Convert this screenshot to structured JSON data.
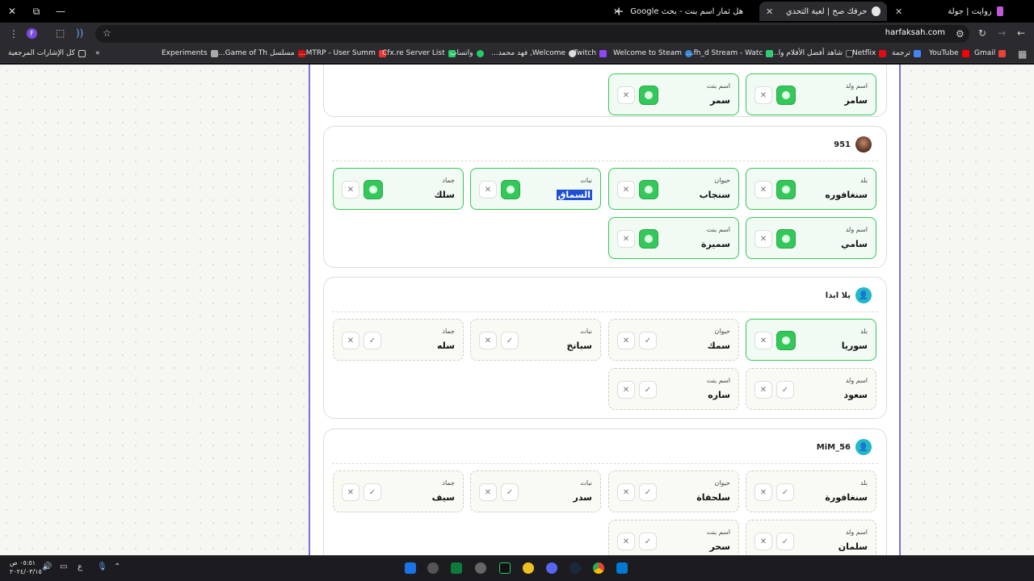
{
  "browser": {
    "tabs": [
      {
        "title": "روايت | جولة",
        "active": false
      },
      {
        "title": "حرفك صح | لعبة التحدي والكلمات",
        "active": true
      },
      {
        "title": "هل ثمار اسم بنت - بحث Google",
        "active": false
      }
    ],
    "url": "harfaksah.com",
    "profile_letter": "F",
    "bookmarks": [
      "Gmail",
      "YouTube",
      "ترجمة",
      "Netflix",
      "شاهد أفضل الأفلام وا...",
      "fh_d Stream - Watc...",
      "Welcome to Steam",
      "Twitch",
      "Welcome, فهد محمد...",
      "واتساب",
      "Cfx.re Server List",
      "MTRP - User Summ...",
      "مسلسل Game of Th...",
      "Experiments"
    ],
    "all_bookmarks": "كل الإشارات المرجعية",
    "overflow": "»"
  },
  "cards": [
    {
      "player": "",
      "answers": [
        {
          "category": "اسم ولد",
          "value": "سامر",
          "approved": true
        },
        {
          "category": "اسم بنت",
          "value": "سمر",
          "approved": true
        }
      ]
    },
    {
      "player": "951",
      "answers": [
        {
          "category": "بلد",
          "value": "سنغافوره",
          "approved": true
        },
        {
          "category": "حيوان",
          "value": "سنجاب",
          "approved": true
        },
        {
          "category": "نبات",
          "value": "السماق",
          "approved": true,
          "selected": true
        },
        {
          "category": "جماد",
          "value": "سلك",
          "approved": true
        },
        {
          "category": "اسم ولد",
          "value": "سامي",
          "approved": true
        },
        {
          "category": "اسم بنت",
          "value": "سميرة",
          "approved": true
        }
      ]
    },
    {
      "player": "يلا ابدا",
      "answers": [
        {
          "category": "بلد",
          "value": "سوريا",
          "approved": true
        },
        {
          "category": "حيوان",
          "value": "سمك",
          "approved": false
        },
        {
          "category": "نبات",
          "value": "سبانخ",
          "approved": false
        },
        {
          "category": "جماد",
          "value": "سله",
          "approved": false
        },
        {
          "category": "اسم ولد",
          "value": "سعود",
          "approved": false
        },
        {
          "category": "اسم بنت",
          "value": "ساره",
          "approved": false
        }
      ]
    },
    {
      "player": "MiM_56",
      "answers": [
        {
          "category": "بلد",
          "value": "سنغافورة",
          "approved": false
        },
        {
          "category": "حيوان",
          "value": "سلحفاة",
          "approved": false
        },
        {
          "category": "نبات",
          "value": "سدر",
          "approved": false
        },
        {
          "category": "جماد",
          "value": "سيف",
          "approved": false
        },
        {
          "category": "اسم ولد",
          "value": "سلمان",
          "approved": false
        },
        {
          "category": "اسم بنت",
          "value": "سحر",
          "approved": false
        }
      ]
    }
  ],
  "taskbar": {
    "time": "٠٥:٥١ ص",
    "date": "٢٠٢٤/٠٣/١٥",
    "lang": "ع"
  },
  "colors": {
    "accent_green": "#34c759",
    "frame_purple": "#7c6fd8",
    "avatar_teal": "#22b8c8",
    "selection_blue": "#1f4fd0"
  }
}
